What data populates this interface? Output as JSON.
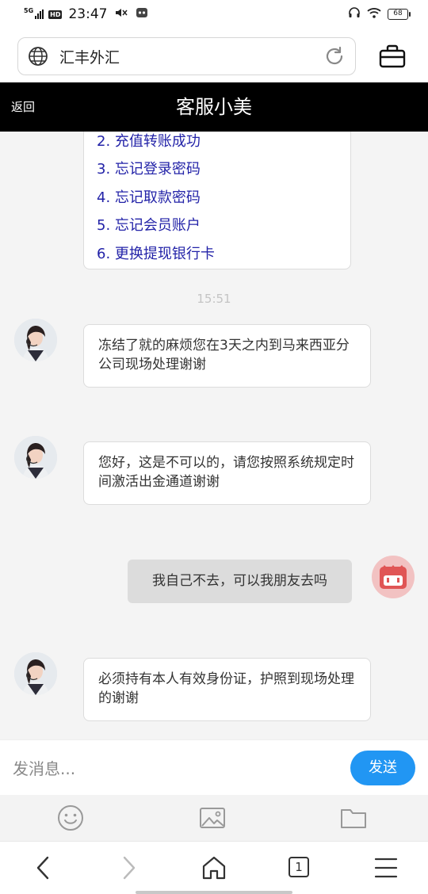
{
  "status_bar": {
    "network": "5G",
    "hd": "HD",
    "time": "23:47",
    "battery": "68"
  },
  "address_bar": {
    "url_text": "汇丰外汇"
  },
  "header": {
    "back_label": "返回",
    "title": "客服小美"
  },
  "menu_card": {
    "options": [
      "2.  充值转账成功",
      "3.  忘记登录密码",
      "4.  忘记取款密码",
      "5.  忘记会员账户",
      "6.  更换提现银行卡"
    ]
  },
  "timestamp": "15:51",
  "messages": [
    {
      "from": "agent",
      "text": "冻结了就的麻烦您在3天之内到马来西亚分公司现场处理谢谢"
    },
    {
      "from": "agent",
      "text": "您好，这是不可以的，请您按照系统规定时间激活出金通道谢谢"
    },
    {
      "from": "user",
      "text": "我自己不去，可以我朋友去吗"
    },
    {
      "from": "agent",
      "text": "必须持有本人有效身份证，护照到现场处理的谢谢"
    }
  ],
  "composer": {
    "placeholder": "发消息...",
    "send_label": "发送"
  },
  "toolbar": {
    "icons": [
      "emoji-icon",
      "image-icon",
      "folder-icon"
    ]
  },
  "nav": {
    "tab_count": "1"
  },
  "colors": {
    "header_bg": "#000000",
    "send_button": "#2196f3",
    "menu_link": "#2323a8",
    "user_avatar_bg": "#f2c2c2",
    "user_avatar_fg": "#e05555"
  }
}
